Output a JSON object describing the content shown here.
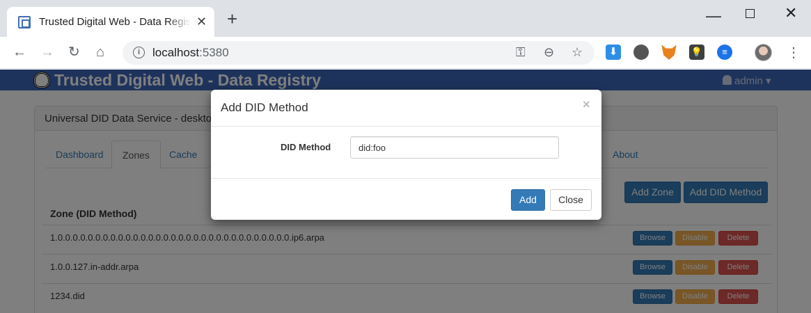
{
  "browser": {
    "tab_title": "Trusted Digital Web - Data Registry",
    "url_host": "localhost",
    "url_port": ":5380"
  },
  "app": {
    "brand": "Trusted Digital Web - Data Registry",
    "user": "admin ▾",
    "panel_title": "Universal DID Data Service - desktop"
  },
  "tabs": [
    "Dashboard",
    "Zones",
    "Cache",
    "About"
  ],
  "actions": {
    "add_zone": "Add Zone",
    "add_did_method": "Add DID Method"
  },
  "table": {
    "header": "Zone (DID Method)",
    "rows": [
      {
        "name": "1.0.0.0.0.0.0.0.0.0.0.0.0.0.0.0.0.0.0.0.0.0.0.0.0.0.0.0.0.0.0.0.ip6.arpa"
      },
      {
        "name": "1.0.0.127.in-addr.arpa"
      },
      {
        "name": "1234.did"
      }
    ],
    "row_buttons": {
      "browse": "Browse",
      "disable": "Disable",
      "delete": "Delete"
    }
  },
  "modal": {
    "title": "Add DID Method",
    "close_x": "×",
    "field_label": "DID Method",
    "field_value": "did:foo",
    "add": "Add",
    "close": "Close"
  }
}
